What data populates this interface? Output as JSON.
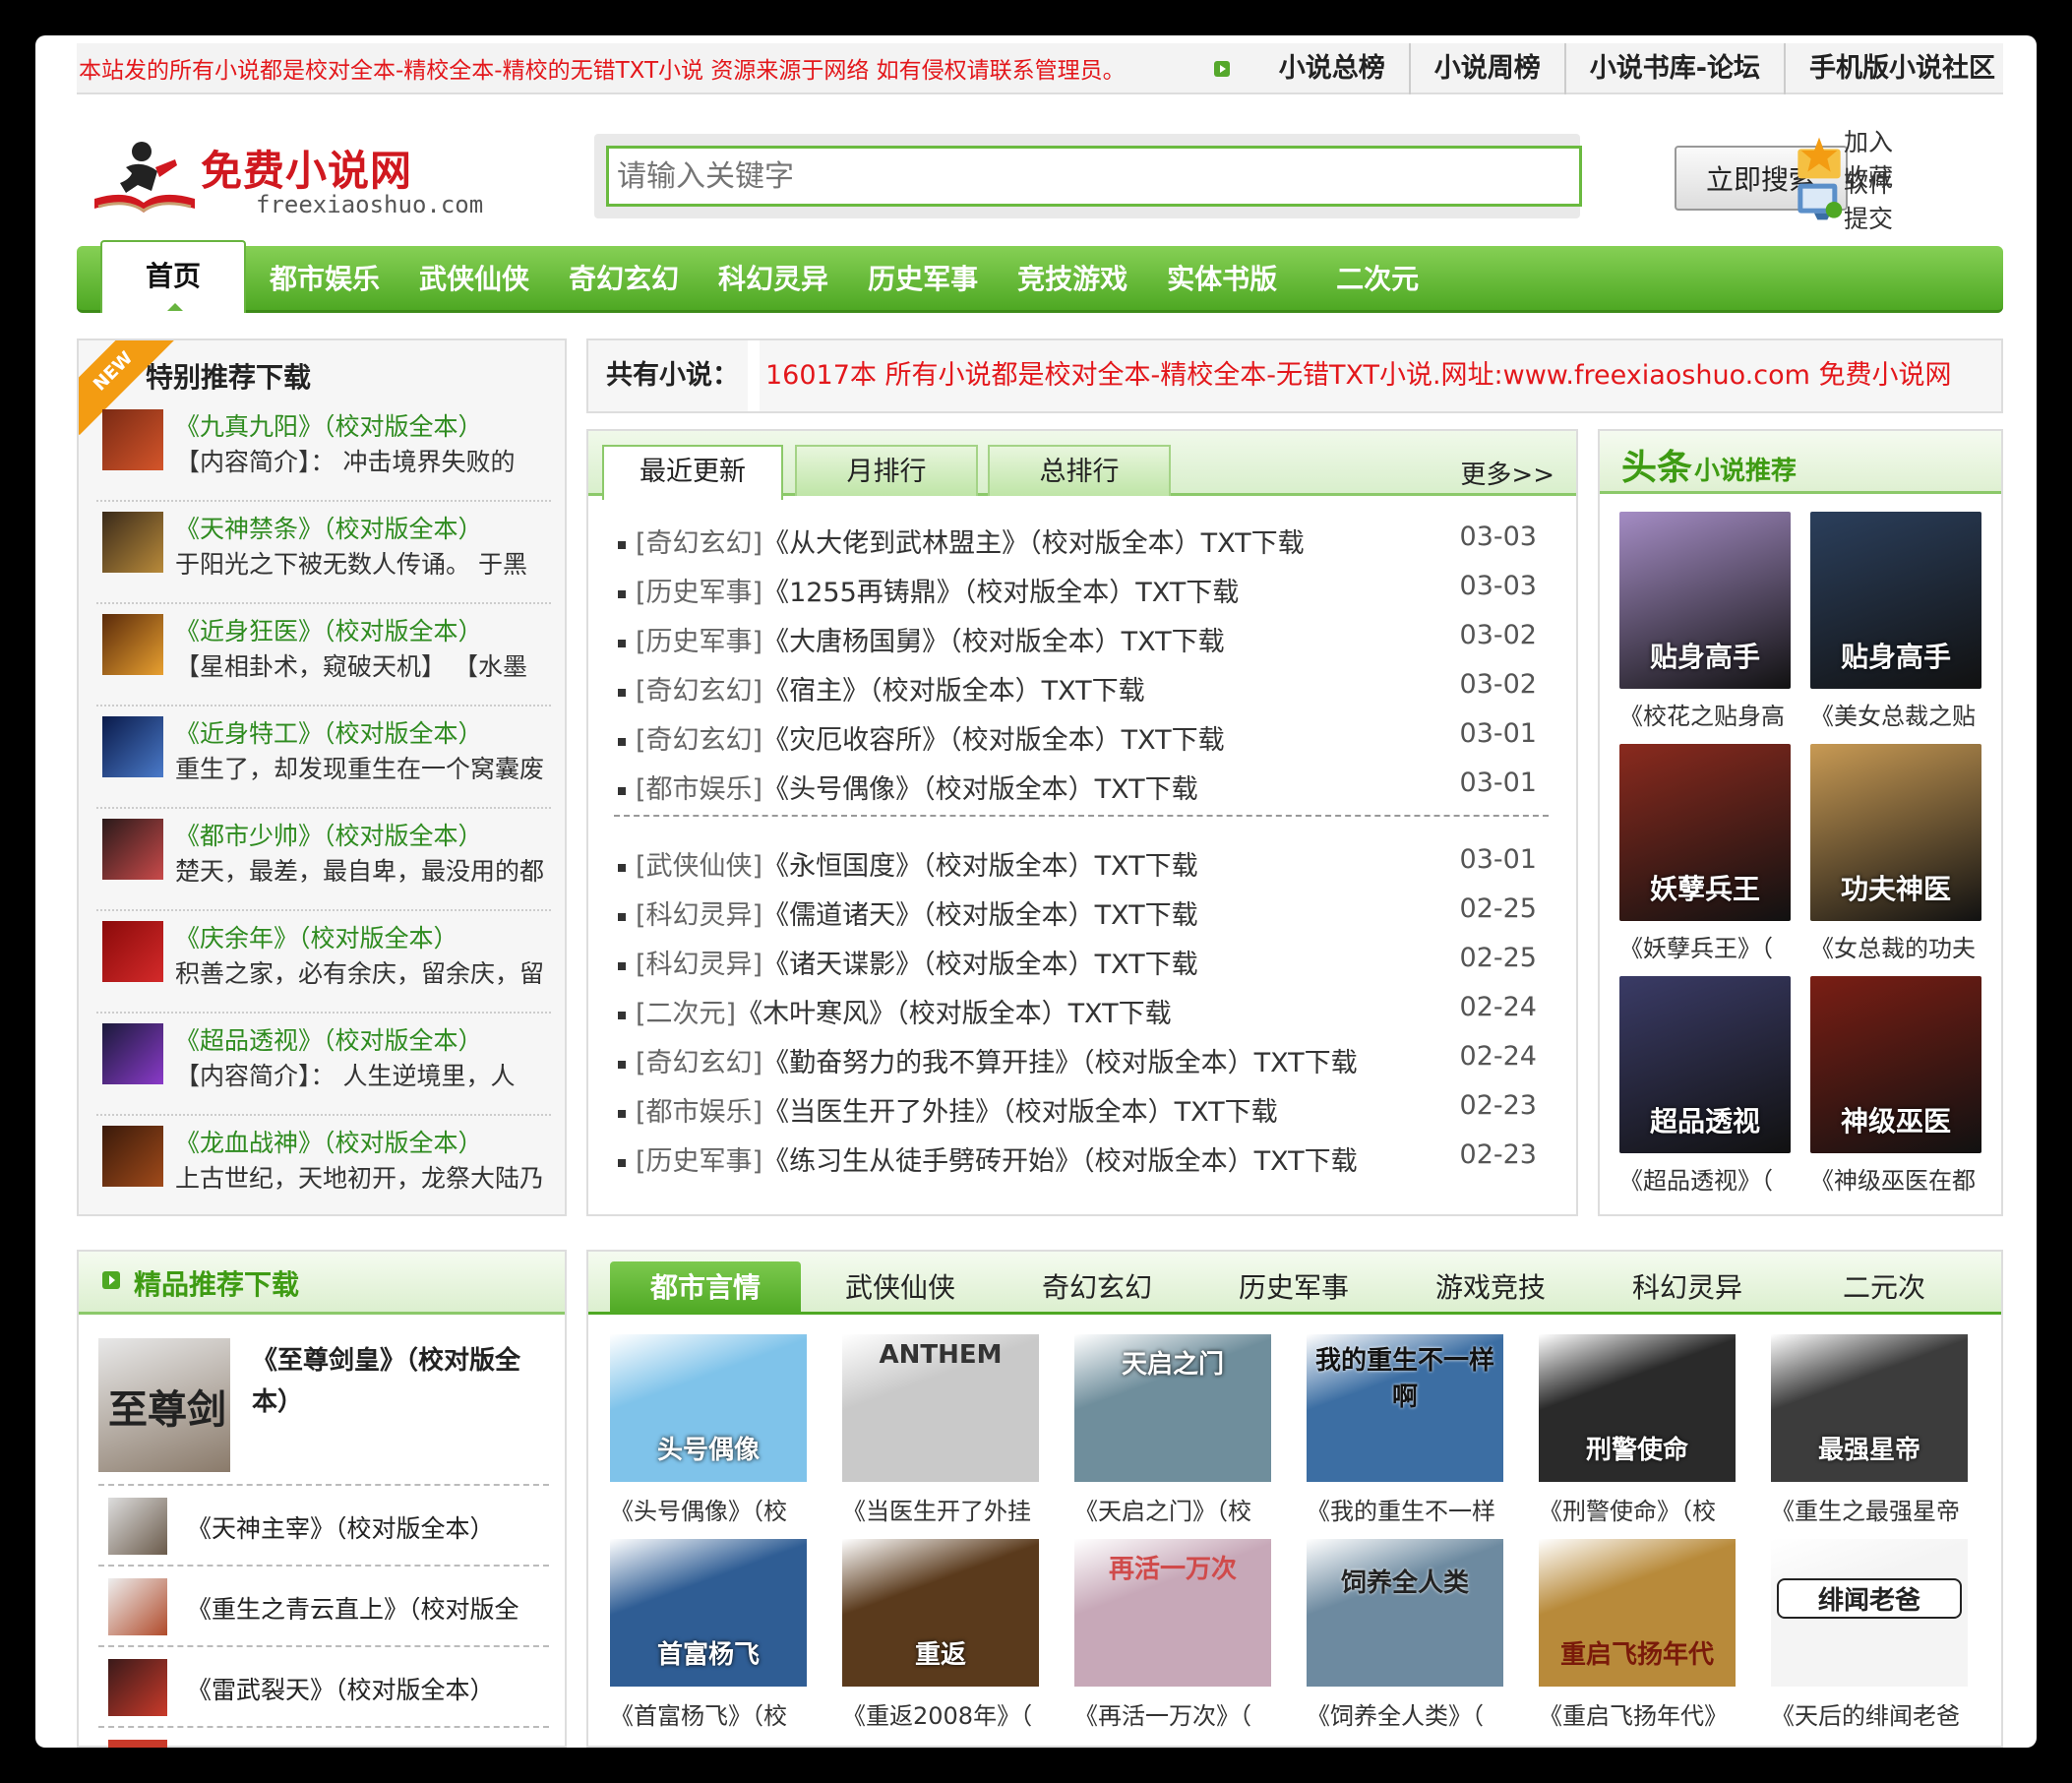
{
  "top": {
    "notice": "本站发的所有小说都是校对全本-精校全本-精校的无错TXT小说 资源来源于网络 如有侵权请联系管理员。",
    "links": [
      "小说总榜",
      "小说周榜",
      "小说书库-论坛",
      "手机版小说社区"
    ]
  },
  "logo": {
    "title": "免费小说网",
    "domain": "freexiaoshuo.com"
  },
  "search": {
    "placeholder": "请输入关键字",
    "button": "立即搜索"
  },
  "side_links": [
    "加入收藏",
    "软件提交"
  ],
  "nav": {
    "home": "首页",
    "items": [
      "都市娱乐",
      "武侠仙侠",
      "奇幻玄幻",
      "科幻灵异",
      "历史军事",
      "竞技游戏",
      "实体书版",
      "二次元"
    ]
  },
  "special": {
    "badge": "NEW",
    "title": "特别推荐下载",
    "items": [
      {
        "title": "《九真九阳》（校对版全本）",
        "desc": "【内容简介】： 冲击境界失败的"
      },
      {
        "title": "《天神禁条》（校对版全本）",
        "desc": "于阳光之下被无数人传诵。 于黑"
      },
      {
        "title": "《近身狂医》（校对版全本）",
        "desc": "【星相卦术，窥破天机】 【水墨"
      },
      {
        "title": "《近身特工》（校对版全本）",
        "desc": "重生了，却发现重生在一个窝囊废"
      },
      {
        "title": "《都市少帅》（校对版全本）",
        "desc": "楚天，最差，最自卑，最没用的都"
      },
      {
        "title": "《庆余年》（校对版全本）",
        "desc": "积善之家，必有余庆，留余庆，留"
      },
      {
        "title": "《超品透视》（校对版全本）",
        "desc": "【内容简介】： 人生逆境里，人"
      },
      {
        "title": "《龙血战神》（校对版全本）",
        "desc": "上古世纪，天地初开，龙祭大陆乃"
      }
    ]
  },
  "counter": {
    "label": "共有小说：",
    "text": "16017本 所有小说都是校对全本-精校全本-无错TXT小说.网址:www.freexiaoshuo.com 免费小说网"
  },
  "latest": {
    "tabs": [
      "最近更新",
      "月排行",
      "总排行"
    ],
    "more": "更多>>",
    "items": [
      {
        "cat": "[奇幻玄幻]",
        "title": "《从大佬到武林盟主》（校对版全本）TXT下载",
        "date": "03-03"
      },
      {
        "cat": "[历史军事]",
        "title": "《1255再铸鼎》（校对版全本）TXT下载",
        "date": "03-03"
      },
      {
        "cat": "[历史军事]",
        "title": "《大唐杨国舅》（校对版全本）TXT下载",
        "date": "03-02"
      },
      {
        "cat": "[奇幻玄幻]",
        "title": "《宿主》（校对版全本）TXT下载",
        "date": "03-02"
      },
      {
        "cat": "[奇幻玄幻]",
        "title": "《灾厄收容所》（校对版全本）TXT下载",
        "date": "03-01"
      },
      {
        "cat": "[都市娱乐]",
        "title": "《头号偶像》（校对版全本）TXT下载",
        "date": "03-01"
      },
      {
        "cat": "[武侠仙侠]",
        "title": "《永恒国度》（校对版全本）TXT下载",
        "date": "03-01"
      },
      {
        "cat": "[科幻灵异]",
        "title": "《儒道诸天》（校对版全本）TXT下载",
        "date": "02-25"
      },
      {
        "cat": "[科幻灵异]",
        "title": "《诸天谍影》（校对版全本）TXT下载",
        "date": "02-25"
      },
      {
        "cat": "[二次元]",
        "title": "《木叶寒风》（校对版全本）TXT下载",
        "date": "02-24"
      },
      {
        "cat": "[奇幻玄幻]",
        "title": "《勤奋努力的我不算开挂》（校对版全本）TXT下载",
        "date": "02-24"
      },
      {
        "cat": "[都市娱乐]",
        "title": "《当医生开了外挂》（校对版全本）TXT下载",
        "date": "02-23"
      },
      {
        "cat": "[历史军事]",
        "title": "《练习生从徒手劈砖开始》（校对版全本）TXT下载",
        "date": "02-23"
      }
    ]
  },
  "headline": {
    "big": "头条",
    "small": "小说推荐",
    "books": [
      {
        "cover": "贴身高手",
        "caption": "《校花之贴身高",
        "color": "#a48cc4"
      },
      {
        "cover": "贴身高手",
        "caption": "《美女总裁之贴",
        "color": "#2b3f5c"
      },
      {
        "cover": "妖孽兵王",
        "caption": "《妖孽兵王》（",
        "color": "#8a2a1e"
      },
      {
        "cover": "功夫神医",
        "caption": "《女总裁的功夫",
        "color": "#c89a54"
      },
      {
        "cover": "超品透视",
        "caption": "《超品透视》（",
        "color": "#3a3b66"
      },
      {
        "cover": "神级巫医",
        "caption": "《神级巫医在都",
        "color": "#7a1e14"
      }
    ]
  },
  "quality": {
    "title": "精品推荐下载",
    "featured": {
      "title": "《至尊剑皇》（校对版全本）",
      "cover_text": "至尊剑"
    },
    "items": [
      "《天神主宰》（校对版全本）",
      "《重生之青云直上》（校对版全",
      "《雷武裂天》（校对版全本）"
    ]
  },
  "genre": {
    "tabs": [
      "都市言情",
      "武侠仙侠",
      "奇幻玄幻",
      "历史军事",
      "游戏竞技",
      "科幻灵异",
      "二元次"
    ],
    "books": [
      {
        "cover": "头号偶像",
        "caption": "《头号偶像》（校",
        "color": "#7fc3ea"
      },
      {
        "cover": "ANTHEM",
        "caption": "《当医生开了外挂",
        "color": "#c9c9c9"
      },
      {
        "cover": "天启之门",
        "caption": "《天启之门》（校",
        "color": "#6f8e9c"
      },
      {
        "cover": "我的重生不一样啊",
        "caption": "《我的重生不一样",
        "color": "#3c6ea3"
      },
      {
        "cover": "刑警使命",
        "caption": "《刑警使命》（校",
        "color": "#2a2a2a"
      },
      {
        "cover": "最强星帝",
        "caption": "《重生之最强星帝",
        "color": "#3c3c3c"
      },
      {
        "cover": "首富杨飞",
        "caption": "《首富杨飞》（校",
        "color": "#2f5d94"
      },
      {
        "cover": "重返",
        "caption": "《重返2008年》（",
        "color": "#5a3a1c"
      },
      {
        "cover": "再活一万次",
        "caption": "《再活一万次》（",
        "color": "#c7a8b8"
      },
      {
        "cover": "饲养全人类",
        "caption": "《饲养全人类》（",
        "color": "#6d8aa0"
      },
      {
        "cover": "重启飞扬年代",
        "caption": "《重启飞扬年代》",
        "color": "#b88a3a"
      },
      {
        "cover": "绯闻老爸",
        "caption": "《天后的绯闻老爸",
        "color": "#f4f4f4"
      }
    ]
  }
}
